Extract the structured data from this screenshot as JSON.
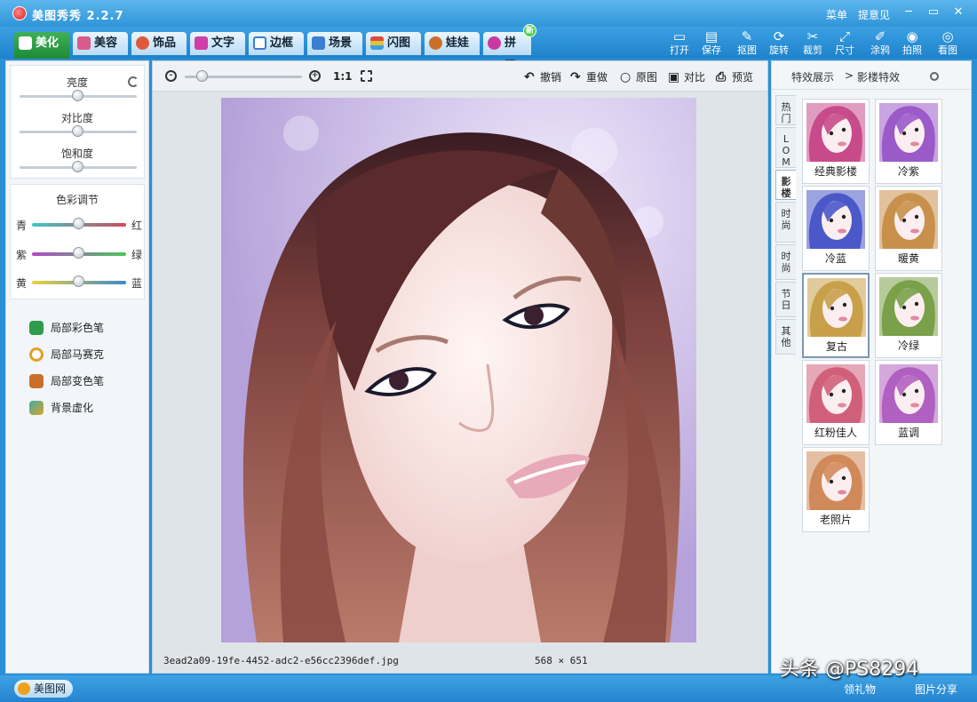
{
  "app": {
    "title": "美图秀秀 2.2.7"
  },
  "titlebar": {
    "menu": "菜单",
    "feedback": "提意见",
    "min": "─",
    "restore": "▭",
    "close": "✕"
  },
  "tabs": [
    {
      "label": "美化",
      "active": true,
      "color": "#2ea24a"
    },
    {
      "label": "美容",
      "color": "#d85c8b"
    },
    {
      "label": "饰品",
      "color": "#e05a3a"
    },
    {
      "label": "文字",
      "color": "#d03ea8"
    },
    {
      "label": "边框",
      "color": "#3a7fd0"
    },
    {
      "label": "场景",
      "color": "#3a7fd0"
    },
    {
      "label": "闪图",
      "color": "#e0a12a"
    },
    {
      "label": "娃娃",
      "color": "#c8702a"
    },
    {
      "label": "拼图",
      "color": "#c83aa0",
      "badge": "新"
    }
  ],
  "toolbar": [
    {
      "glyph": "▭",
      "label": "打开",
      "icon": "folder-icon"
    },
    {
      "glyph": "▤",
      "label": "保存",
      "icon": "save-icon"
    },
    {
      "glyph": "✎",
      "label": "抠图",
      "icon": "cutout-icon"
    },
    {
      "glyph": "⟳",
      "label": "旋转",
      "icon": "rotate-icon"
    },
    {
      "glyph": "✂",
      "label": "裁剪",
      "icon": "crop-icon"
    },
    {
      "glyph": "⤢",
      "label": "尺寸",
      "icon": "resize-icon"
    },
    {
      "glyph": "✐",
      "label": "涂鸦",
      "icon": "doodle-icon"
    },
    {
      "glyph": "◉",
      "label": "拍照",
      "icon": "camera-icon"
    },
    {
      "glyph": "◎",
      "label": "看图",
      "icon": "view-icon"
    }
  ],
  "adjust": {
    "brightness": {
      "label": "亮度",
      "value": 0.5
    },
    "contrast": {
      "label": "对比度",
      "value": 0.5
    },
    "saturation": {
      "label": "饱和度",
      "value": 0.5
    }
  },
  "color_adjust": {
    "title": "色彩调节",
    "rows": [
      {
        "left": "青",
        "right": "红",
        "value": 0.5,
        "c1": "#3fc7c7",
        "c2": "#d04a5a"
      },
      {
        "left": "紫",
        "right": "绿",
        "value": 0.5,
        "c1": "#b04ac8",
        "c2": "#4ac85a"
      },
      {
        "left": "黄",
        "right": "蓝",
        "value": 0.5,
        "c1": "#e8d23a",
        "c2": "#3a8ad0"
      }
    ]
  },
  "tools": [
    {
      "label": "局部彩色笔",
      "icon": "color-brush-icon",
      "color": "#2e9c4a"
    },
    {
      "label": "局部马赛克",
      "icon": "mosaic-icon",
      "color": "#e0a12a"
    },
    {
      "label": "局部变色笔",
      "icon": "recolor-brush-icon",
      "color": "#c8702a"
    },
    {
      "label": "背景虚化",
      "icon": "blur-icon",
      "color": "#3ab0a0"
    }
  ],
  "canvas": {
    "zoom_value": 0.15,
    "one_to_one": "1:1",
    "actions": [
      {
        "glyph": "↶",
        "label": "撤销",
        "icon": "undo-icon"
      },
      {
        "glyph": "↷",
        "label": "重做",
        "icon": "redo-icon"
      },
      {
        "glyph": "○",
        "label": "原图",
        "icon": "original-icon"
      },
      {
        "glyph": "▣",
        "label": "对比",
        "icon": "compare-icon"
      },
      {
        "glyph": "⎙",
        "label": "预览",
        "icon": "preview-icon"
      }
    ],
    "filename": "3ead2a09-19fe-4452-adc2-e56cc2396def.jpg",
    "dimensions": "568 × 651"
  },
  "effects_panel": {
    "crumb1": "特效展示",
    "sep": ">",
    "crumb2": "影楼特效",
    "vtabs": [
      "热门",
      "LOMO",
      "影楼",
      "时尚",
      "时尚",
      "节日",
      "其他"
    ],
    "vtabs_display": [
      {
        "text": "热\n门"
      },
      {
        "text": "L\nO\nM\nO"
      },
      {
        "text": "影\n楼",
        "active": true
      },
      {
        "text": "时\n尚"
      },
      {
        "text": "时\n尚"
      },
      {
        "text": "节\n日"
      },
      {
        "text": "其\n他"
      }
    ],
    "effects": [
      {
        "label": "经典影楼",
        "tint": "#c74a8a"
      },
      {
        "label": "冷紫",
        "tint": "#9a5ac8"
      },
      {
        "label": "冷蓝",
        "tint": "#4a58c8"
      },
      {
        "label": "暖黄",
        "tint": "#c8904a"
      },
      {
        "label": "复古",
        "tint": "#c8a04a",
        "selected": true
      },
      {
        "label": "冷绿",
        "tint": "#7aa04a"
      },
      {
        "label": "红粉佳人",
        "tint": "#d0607a"
      },
      {
        "label": "蓝调",
        "tint": "#b060c0"
      },
      {
        "label": "老照片",
        "tint": "#d08a5a"
      }
    ]
  },
  "bottom": {
    "site_label": "美图网",
    "gift": "领礼物",
    "share": "图片分享"
  },
  "watermark": "头条 @PS8294"
}
